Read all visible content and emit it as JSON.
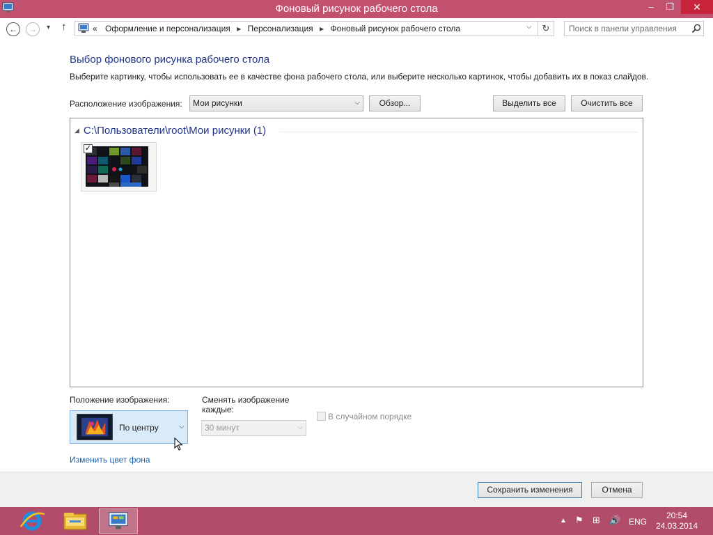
{
  "window": {
    "title": "Фоновый рисунок рабочего стола",
    "minimize_glyph": "–",
    "restore_glyph": "❐",
    "close_glyph": "✕"
  },
  "nav": {
    "back_glyph": "←",
    "forward_glyph": "→",
    "history_glyph": "▾",
    "up_glyph": "↑",
    "breadcrumb_prefix": "«",
    "breadcrumbs": [
      "Оформление и персонализация",
      "Персонализация",
      "Фоновый рисунок рабочего стола"
    ],
    "breadcrumb_sep": "▶",
    "dropdown_glyph": "⌵",
    "refresh_glyph": "↻",
    "search_placeholder": "Поиск в панели управления"
  },
  "main": {
    "heading": "Выбор фонового рисунка рабочего стола",
    "description": "Выберите картинку, чтобы использовать ее в качестве фона рабочего стола, или выберите несколько картинок, чтобы добавить их в показ слайдов.",
    "location_label": "Расположение изображения:",
    "location_value": "Мои рисунки",
    "browse_label": "Обзор...",
    "select_all_label": "Выделить все",
    "clear_all_label": "Очистить все",
    "group_title": "C:\\Пользователи\\root\\Мои рисунки (1)",
    "group_toggle_glyph": "◢",
    "thumbnail_checked": true,
    "check_glyph": "✓"
  },
  "options": {
    "position_label": "Положение изображения:",
    "position_value": "По центру",
    "change_label": "Сменять изображение каждые:",
    "interval_value": "30 минут",
    "shuffle_label": "В случайном порядке",
    "shuffle_checked": false,
    "change_color_link": "Изменить цвет фона",
    "chevron_glyph": "⌵"
  },
  "footer": {
    "save_label": "Сохранить изменения",
    "cancel_label": "Отмена"
  },
  "taskbar": {
    "tray_up_glyph": "▲",
    "flag_glyph": "⚑",
    "network_glyph": "⊞",
    "volume_glyph": "🔊",
    "language": "ENG",
    "time": "20:54",
    "date": "24.03.2014"
  },
  "colors": {
    "accent": "#c2506f",
    "taskbar": "#b14d6a",
    "close": "#c7243b",
    "heading": "#1e3287",
    "link": "#1c5fae"
  }
}
